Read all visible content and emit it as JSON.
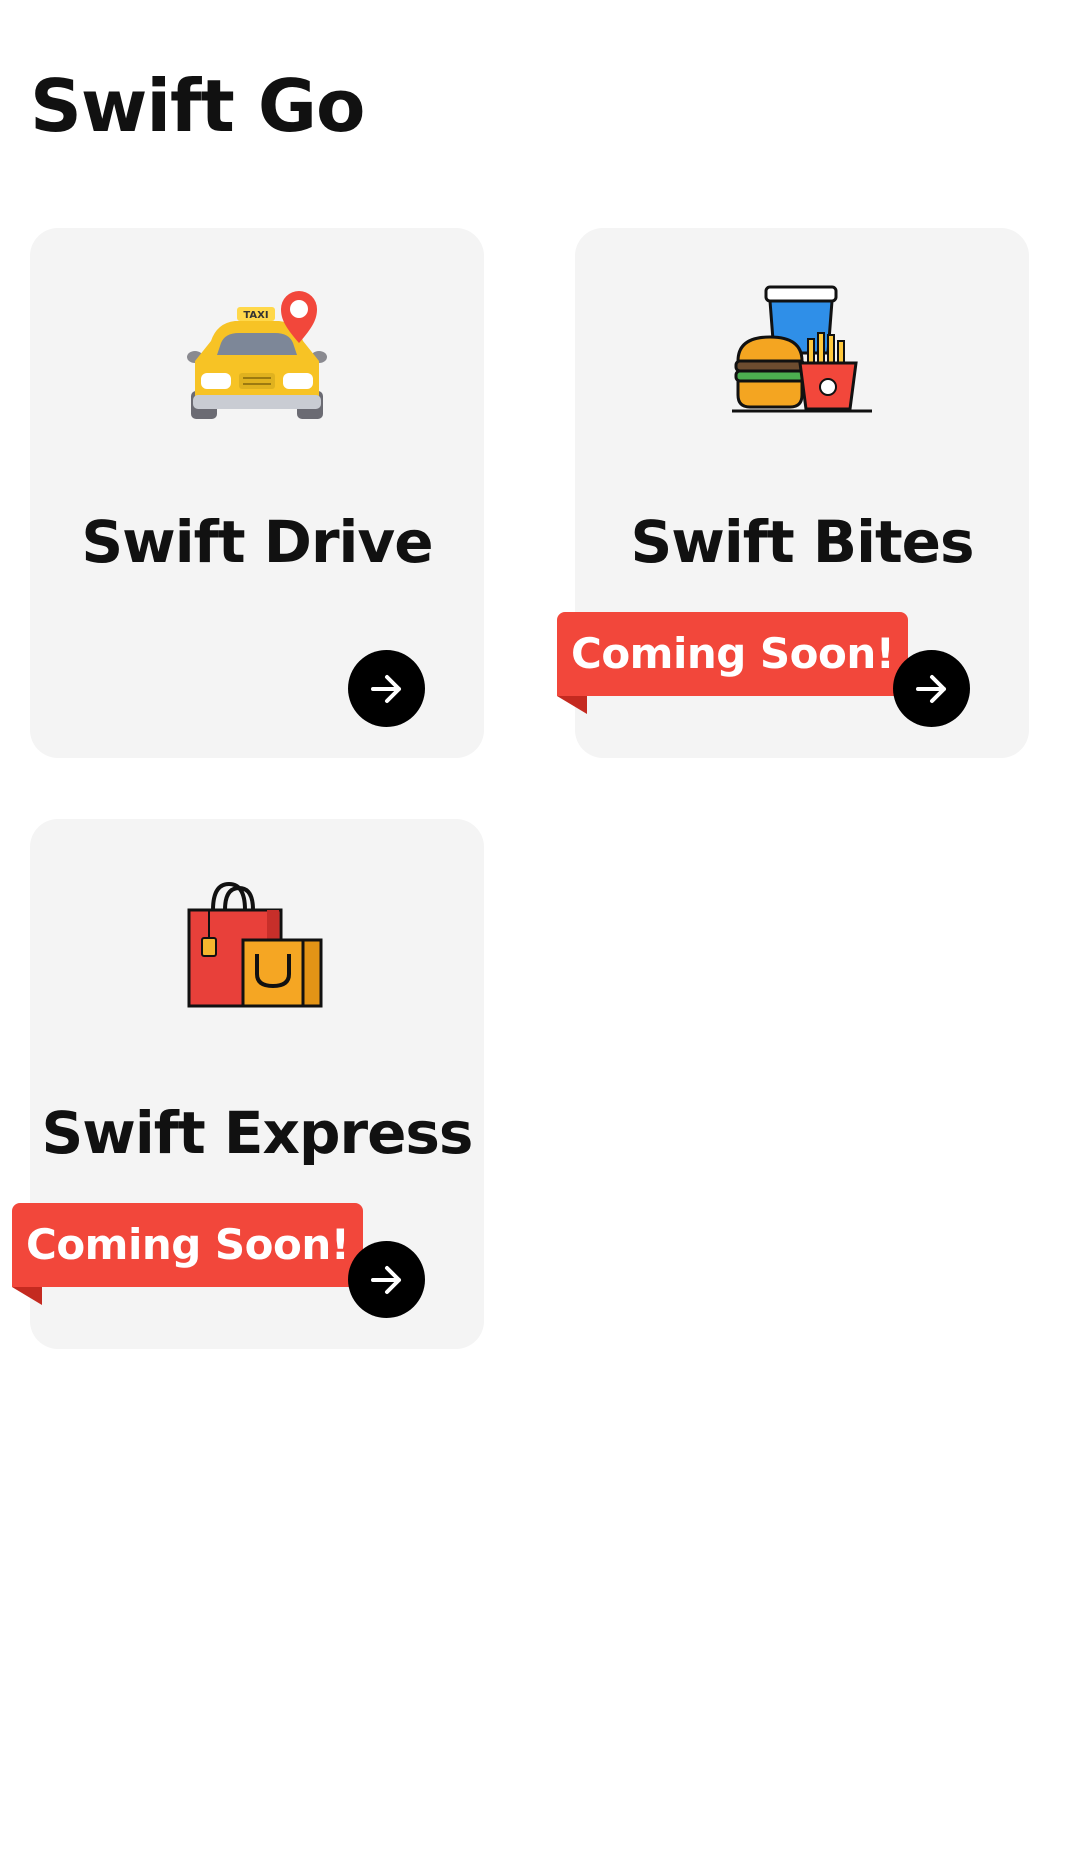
{
  "app": {
    "title": "Swift Go"
  },
  "services": [
    {
      "label": "Swift Drive",
      "icon": "taxi-location-icon",
      "badge": ""
    },
    {
      "label": "Swift Bites",
      "icon": "fast-food-icon",
      "badge": "Coming Soon!"
    },
    {
      "label": "Swift Express",
      "icon": "shopping-bags-icon",
      "badge": "Coming Soon!"
    }
  ],
  "colors": {
    "card_background": "#f4f4f4",
    "badge_background": "#f2473b",
    "arrow_button": "#000000"
  }
}
